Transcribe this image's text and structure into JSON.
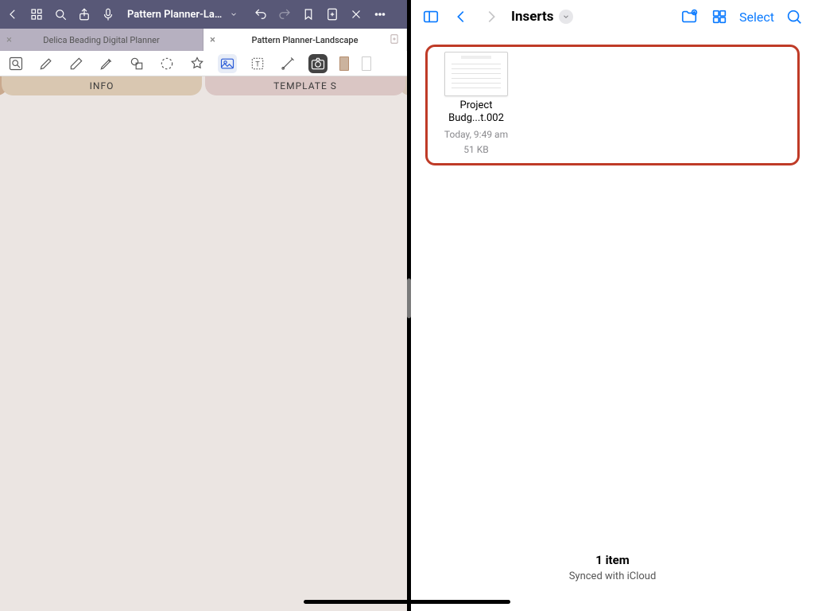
{
  "left": {
    "doc_title": "Pattern Planner-La...",
    "tabs": [
      {
        "label": "Delica Beading Digital Planner",
        "active": false
      },
      {
        "label": "Pattern Planner-Landscape",
        "active": true
      }
    ],
    "category_tabs": {
      "info": "INFO",
      "templates": "TEMPLATE S"
    }
  },
  "right": {
    "location_title": "Inserts",
    "select_label": "Select",
    "files": [
      {
        "name_line1": "Project",
        "name_line2": "Budg...t.002",
        "timestamp": "Today, 9:49 am",
        "size": "51 KB"
      }
    ],
    "footer": {
      "count": "1 item",
      "sync": "Synced with iCloud"
    }
  },
  "colors": {
    "ios_blue": "#0a7aff",
    "highlight_border": "#bf3b27"
  }
}
